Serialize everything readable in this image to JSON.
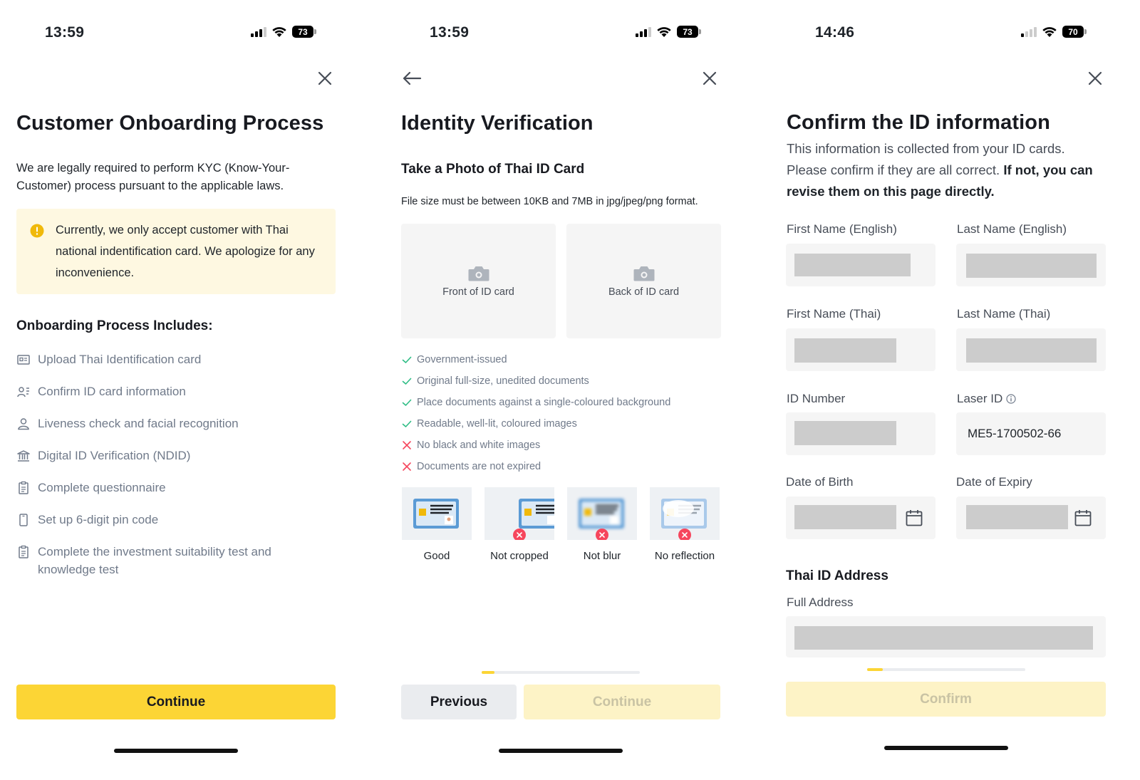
{
  "screens": {
    "onboarding": {
      "time": "13:59",
      "battery": "73",
      "title": "Customer Onboarding Process",
      "intro": "We are legally required to perform KYC (Know-Your-Customer) process pursuant to the applicable laws.",
      "notice": "Currently, we only accept customer with Thai national indentification card. We apologize for any inconvenience.",
      "steps_heading": "Onboarding Process Includes:",
      "steps": [
        {
          "label": "Upload Thai Identification card",
          "icon": "id-card-icon"
        },
        {
          "label": "Confirm ID card information",
          "icon": "user-list-icon"
        },
        {
          "label": "Liveness check and facial recognition",
          "icon": "person-icon"
        },
        {
          "label": "Digital ID Verification (NDID)",
          "icon": "bank-icon"
        },
        {
          "label": "Complete questionnaire",
          "icon": "clipboard-icon"
        },
        {
          "label": "Set up 6-digit pin code",
          "icon": "phone-icon"
        },
        {
          "label": "Complete the investment suitability test and knowledge test",
          "icon": "clipboard-icon"
        }
      ],
      "continue_label": "Continue"
    },
    "identity": {
      "time": "13:59",
      "battery": "73",
      "title": "Identity Verification",
      "subtitle": "Take a Photo of Thai ID Card",
      "file_note": "File size must be between 10KB and 7MB in jpg/jpeg/png format.",
      "front_label": "Front of ID card",
      "back_label": "Back of ID card",
      "requirements": [
        {
          "text": "Government-issued",
          "ok": true
        },
        {
          "text": "Original full-size, unedited documents",
          "ok": true
        },
        {
          "text": "Place documents against a single-coloured background",
          "ok": true
        },
        {
          "text": "Readable, well-lit, coloured images",
          "ok": true
        },
        {
          "text": "No black and white images",
          "ok": false
        },
        {
          "text": "Documents are not expired",
          "ok": false
        }
      ],
      "samples": [
        "Good",
        "Not cropped",
        "Not blur",
        "No reflection"
      ],
      "progress": 0.08,
      "previous_label": "Previous",
      "continue_label": "Continue"
    },
    "confirm": {
      "time": "14:46",
      "battery": "70",
      "title": "Confirm the ID information",
      "desc_plain": "This information is collected from your ID cards. Please confirm if they are all correct. ",
      "desc_bold": "If not, you can revise them on this page directly.",
      "first_name_en": "First Name (English)",
      "last_name_en": "Last Name (English)",
      "first_name_th": "First Name (Thai)",
      "last_name_th": "Last Name (Thai)",
      "id_number": "ID Number",
      "laser_id": "Laser ID",
      "laser_id_value": "ME5-1700502-66",
      "dob": "Date of Birth",
      "doe": "Date of Expiry",
      "address_heading": "Thai ID Address",
      "full_address": "Full Address",
      "progress": 0.1,
      "confirm_label": "Confirm"
    }
  },
  "colors": {
    "accent": "#fcd535",
    "accent_disabled": "#fdf3c6",
    "notice_bg": "#fef8e1",
    "success": "#2ebd85",
    "error": "#f6465d",
    "muted_text": "#707a8a"
  }
}
